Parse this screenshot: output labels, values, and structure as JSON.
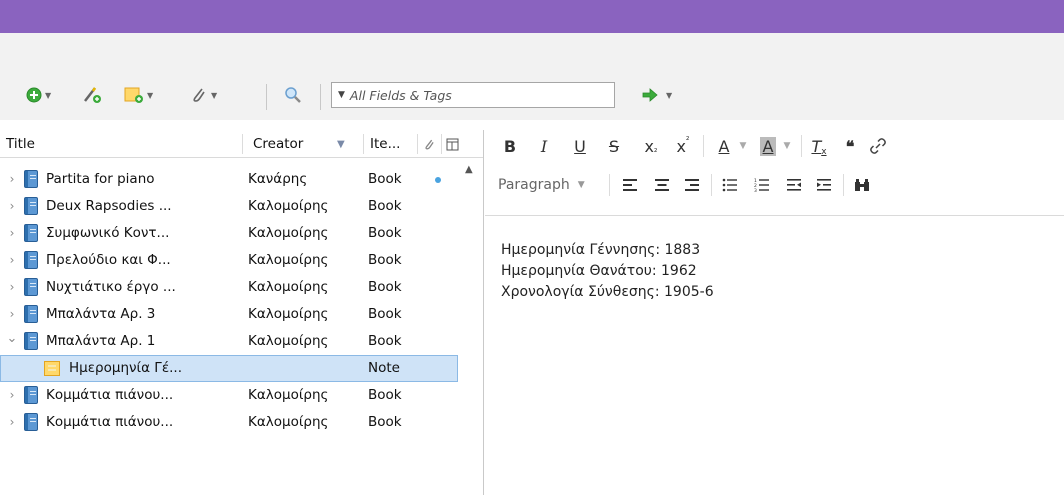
{
  "search": {
    "placeholder": "All Fields & Tags"
  },
  "columns": {
    "title": "Title",
    "creator": "Creator",
    "item_type": "Ite..."
  },
  "rows": [
    {
      "title": "Partita for piano",
      "creator": "Κανάρης",
      "type": "Book",
      "twisty": "›",
      "has_attachment_dot": true
    },
    {
      "title": "Deux Rapsodies ...",
      "creator": "Καλομοίρης",
      "type": "Book",
      "twisty": "›"
    },
    {
      "title": "Συμφωνικό Κοντ...",
      "creator": "Καλομοίρης",
      "type": "Book",
      "twisty": "›"
    },
    {
      "title": "Πρελούδιο και Φ...",
      "creator": "Καλομοίρης",
      "type": "Book",
      "twisty": "›"
    },
    {
      "title": "Νυχτιάτικο έργο ...",
      "creator": "Καλομοίρης",
      "type": "Book",
      "twisty": "›"
    },
    {
      "title": "Μπαλάντα Αρ. 3",
      "creator": "Καλομοίρης",
      "type": "Book",
      "twisty": "›"
    },
    {
      "title": "Μπαλάντα Αρ. 1",
      "creator": "Καλομοίρης",
      "type": "Book",
      "twisty": "⌄",
      "expanded": true
    },
    {
      "title": "Ημερομηνία Γέ...",
      "creator": "",
      "type": "Note",
      "selected": true,
      "is_note": true
    },
    {
      "title": "Κομμάτια πιάνου...",
      "creator": "Καλομοίρης",
      "type": "Book",
      "twisty": "›"
    },
    {
      "title": "Κομμάτια πιάνου...",
      "creator": "Καλομοίρης",
      "type": "Book",
      "twisty": "›"
    }
  ],
  "editor": {
    "paragraph_label": "Paragraph",
    "lines": [
      "Ημερομηνία Γέννησης: 1883",
      "Ημερομηνία Θανάτου: 1962",
      "Χρονολογία Σύνθεσης: 1905-6"
    ]
  },
  "colors": {
    "titlebar": "#8a63bf",
    "selection": "#cfe3f7",
    "book_icon": "#5c98d4",
    "note_icon": "#ffd86a",
    "new_item_green": "#3cab3c",
    "arrow_green": "#3cab3c"
  },
  "icons": {
    "new_item": "plus-circle-icon",
    "new_item_by_identifier": "magic-wand-icon",
    "new_note": "note-add-icon",
    "add_attachment": "paperclip-icon",
    "advanced_search": "magnifier-icon",
    "locate": "green-arrow-icon"
  }
}
